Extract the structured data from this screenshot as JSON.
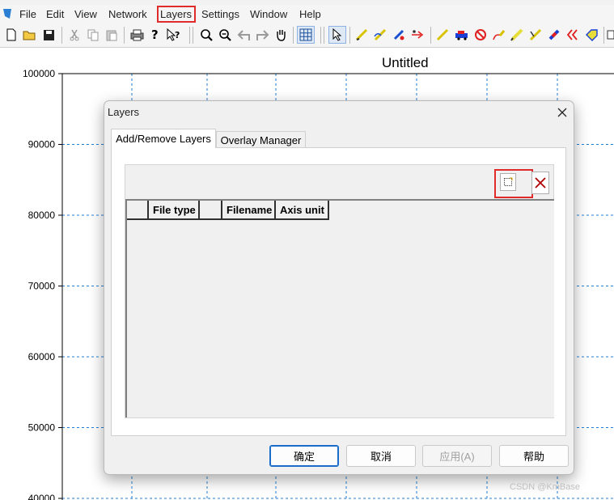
{
  "window": {
    "title": "Untitled"
  },
  "menu": [
    "File",
    "Edit",
    "View",
    "Network",
    "Layers",
    "Settings",
    "Window",
    "Help"
  ],
  "toolbar": {
    "icons": [
      "new-file-icon",
      "open-folder-icon",
      "save-icon",
      "cut-icon",
      "copy-icon",
      "paste-icon",
      "print-icon",
      "help-icon",
      "whats-this-icon",
      "zoom-in-icon",
      "zoom-out-icon",
      "back-icon",
      "forward-icon",
      "pan-hand-icon",
      "grid-icon",
      "select-arrow-icon",
      "draw-line-icon",
      "draw-polyline-icon",
      "edit-node-icon",
      "network-tool-icon",
      "pencil-icon",
      "car-icon",
      "no-entry-icon",
      "route-icon",
      "pen-icon",
      "marker-icon",
      "eraser-icon",
      "bracket-icon",
      "tag-icon"
    ]
  },
  "plot": {
    "title": "Untitled",
    "y_ticks": [
      "100000",
      "90000",
      "80000",
      "70000",
      "60000",
      "50000",
      "40000"
    ]
  },
  "dialog": {
    "title": "Layers",
    "tabs": [
      {
        "label": "Add/Remove Layers",
        "active": true
      },
      {
        "label": "Overlay Manager",
        "active": false
      }
    ],
    "grid_headers": [
      "",
      "File type",
      "",
      "Filename",
      "Axis unit"
    ],
    "buttons": {
      "ok": "确定",
      "cancel": "取消",
      "apply": "应用(A)",
      "help": "帮助"
    }
  },
  "watermark": "CSDN @KmBase",
  "colors": {
    "highlight": "#e02b2b",
    "grid": "#1f7fd6",
    "default_button_border": "#1a6ec9"
  }
}
